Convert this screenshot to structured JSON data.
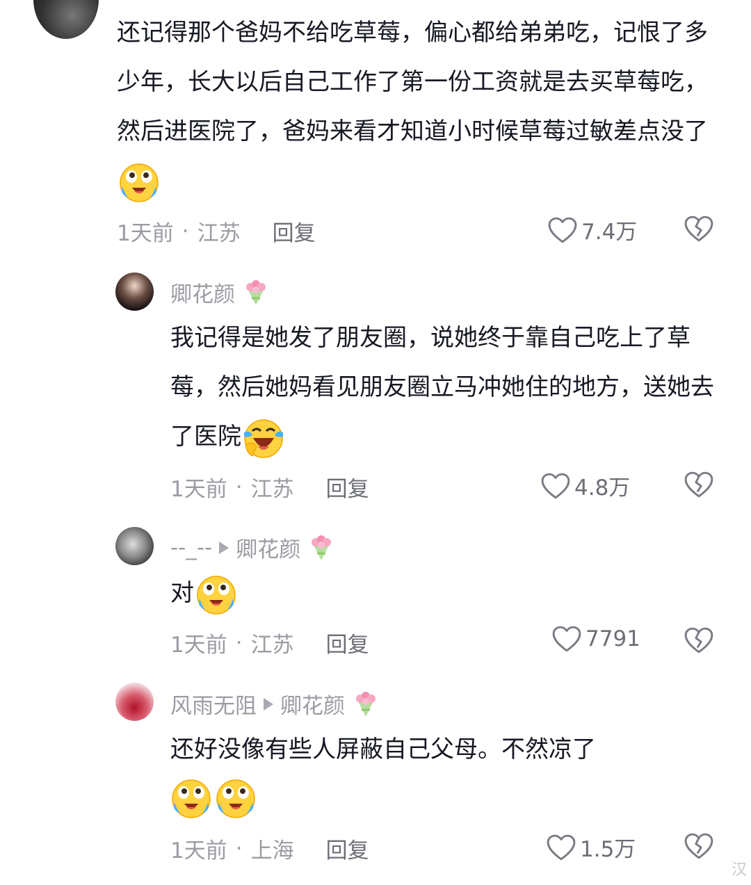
{
  "main_comment": {
    "text": "还记得那个爸妈不给吃草莓，偏心都给弟弟吃，记恨了多少年，长大以后自己工作了第一份工资就是去买草莓吃，然后进医院了，爸妈来看才知道小时候草莓过敏差点没了",
    "emoji": "crying-face",
    "time": "1天前",
    "location": "江苏",
    "reply_label": "回复",
    "likes": "7.4万"
  },
  "replies": [
    {
      "username": "卿花颜",
      "username_emoji": "bouquet",
      "text": "我记得是她发了朋友圈，说她终于靠自己吃上了草莓，然后她妈看见朋友圈立马冲她住的地方，送她去了医院",
      "emoji": "laughing-crying-face",
      "time": "1天前",
      "location": "江苏",
      "reply_label": "回复",
      "likes": "4.8万"
    },
    {
      "username": "--_--",
      "reply_to": "卿花颜",
      "text": "对",
      "emoji": "crying-face",
      "time": "1天前",
      "location": "江苏",
      "reply_label": "回复",
      "likes": "7791"
    },
    {
      "username": "风雨无阻",
      "reply_to": "卿花颜",
      "text": "还好没像有些人屏蔽自己父母。不然凉了",
      "emoji": "crying-face",
      "time": "1天前",
      "location": "上海",
      "reply_label": "回复",
      "likes": "1.5万"
    }
  ],
  "watermark": "汉",
  "colors": {
    "text": "#161823",
    "meta": "#9a9ca3",
    "background": "#ffffff"
  }
}
